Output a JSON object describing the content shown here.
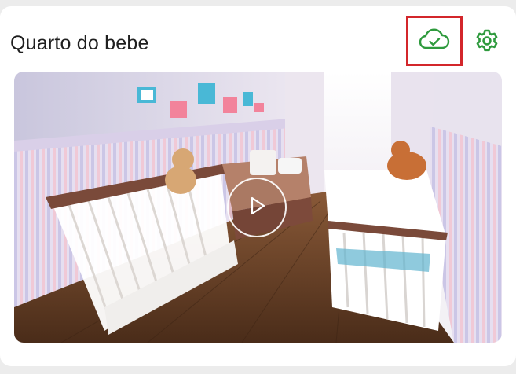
{
  "camera": {
    "name": "Quarto do bebe"
  },
  "icons": {
    "cloud": "cloud-check-icon",
    "settings": "gear-icon",
    "play": "play-icon"
  },
  "colors": {
    "accent": "#2e9a3d",
    "highlight": "#d3262b"
  }
}
